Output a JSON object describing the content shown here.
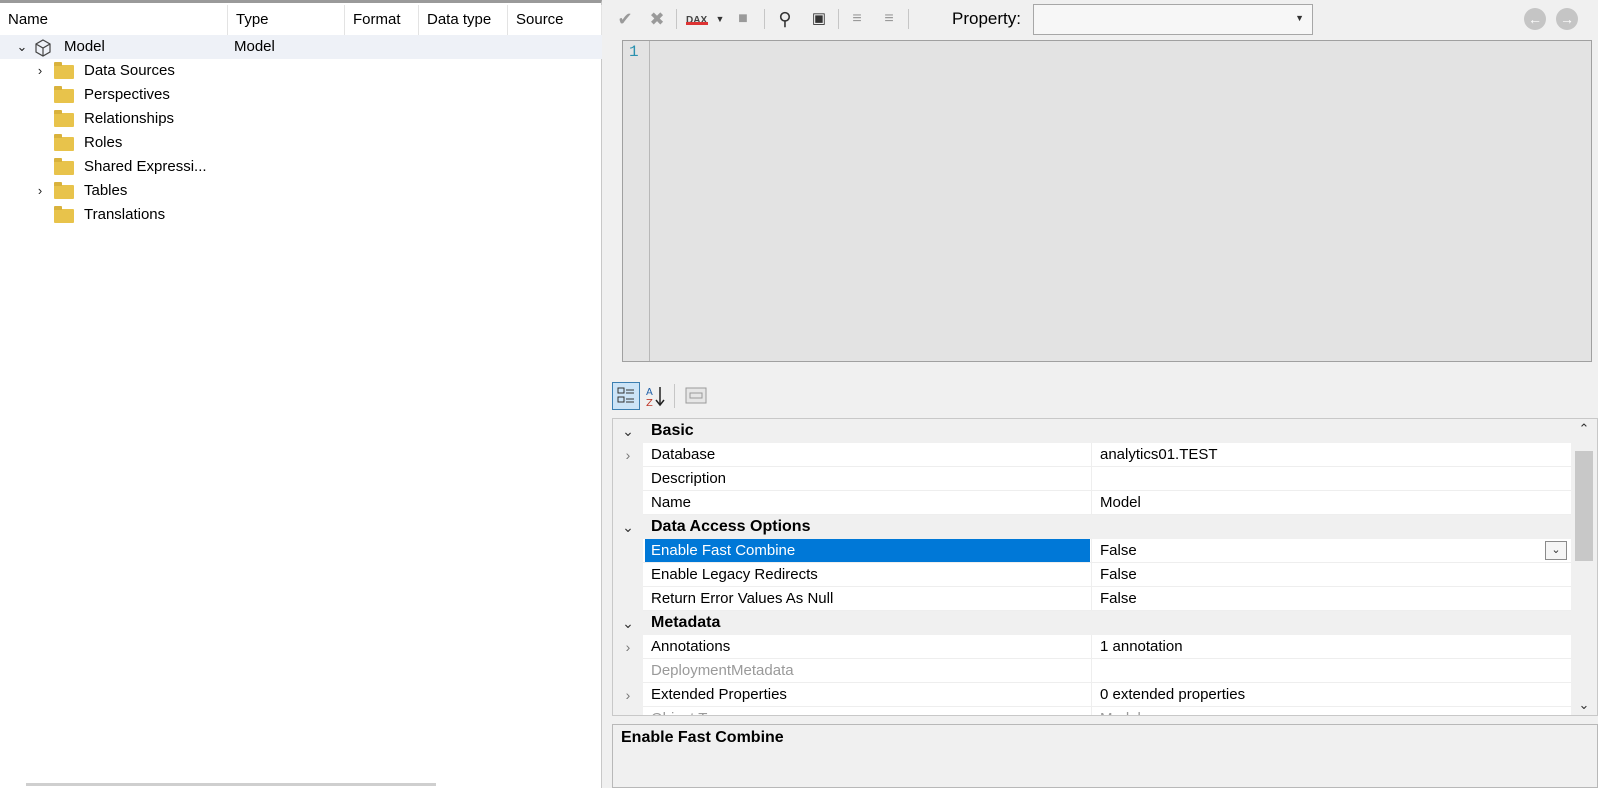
{
  "tree": {
    "columns": [
      "Name",
      "Type",
      "Format",
      "Data type",
      "Source"
    ],
    "root": {
      "name": "Model",
      "type": "Model",
      "icon": "cube-icon"
    },
    "children": [
      {
        "name": "Data Sources",
        "expandable": true
      },
      {
        "name": "Perspectives",
        "expandable": false
      },
      {
        "name": "Relationships",
        "expandable": false
      },
      {
        "name": "Roles",
        "expandable": false
      },
      {
        "name": "Shared Expressi...",
        "expandable": false
      },
      {
        "name": "Tables",
        "expandable": true
      },
      {
        "name": "Translations",
        "expandable": false
      }
    ]
  },
  "editor": {
    "property_label": "Property:",
    "property_value": "",
    "line_number": "1",
    "dax_badge": "DAX",
    "toolbar_icons": [
      "accept-icon",
      "cancel-icon",
      "dax-format-icon",
      "dropdown-icon",
      "copy-to-icon",
      "find-icon",
      "replace-icon",
      "comment-icon",
      "uncomment-icon"
    ],
    "nav_icons": [
      "back-icon",
      "forward-icon"
    ]
  },
  "property_grid": {
    "toolbar_icons": [
      "categorized-icon",
      "alphabetical-sort-icon",
      "property-pages-icon"
    ],
    "rows": [
      {
        "kind": "category",
        "name": "Basic"
      },
      {
        "kind": "prop",
        "name": "Database",
        "value": "analytics01.TEST",
        "expandable": true
      },
      {
        "kind": "prop",
        "name": "Description",
        "value": ""
      },
      {
        "kind": "prop",
        "name": "Name",
        "value": "Model"
      },
      {
        "kind": "category",
        "name": "Data Access Options"
      },
      {
        "kind": "prop",
        "name": "Enable Fast Combine",
        "value": "False",
        "selected": true
      },
      {
        "kind": "prop",
        "name": "Enable Legacy Redirects",
        "value": "False"
      },
      {
        "kind": "prop",
        "name": "Return Error Values As Null",
        "value": "False"
      },
      {
        "kind": "category",
        "name": "Metadata"
      },
      {
        "kind": "prop",
        "name": "Annotations",
        "value": "1 annotation",
        "expandable": true
      },
      {
        "kind": "prop",
        "name": "DeploymentMetadata",
        "value": "",
        "disabled": true
      },
      {
        "kind": "prop",
        "name": "Extended Properties",
        "value": "0 extended properties",
        "expandable": true
      },
      {
        "kind": "prop",
        "name": "Object Type",
        "value": "Model",
        "disabled": true
      }
    ]
  },
  "description": {
    "title": "Enable Fast Combine"
  },
  "colors": {
    "selection": "#0078d7",
    "folder": "#e8c34b",
    "line_number": "#2b91af",
    "editor_bg": "#e3e3e3"
  }
}
